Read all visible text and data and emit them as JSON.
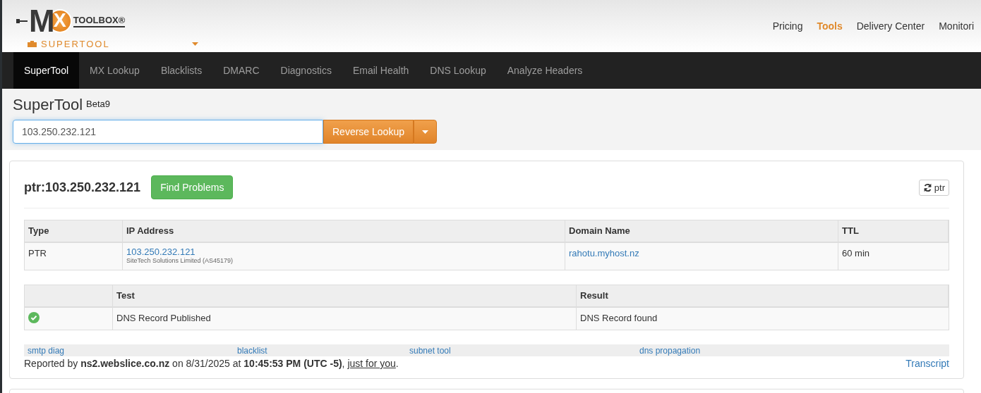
{
  "logo": {
    "letter_m": "M",
    "letter_x": "X",
    "wordmark": "TOOLBOX®",
    "product": "SUPERTOOL"
  },
  "top_nav": [
    {
      "label": "Pricing",
      "selected": false
    },
    {
      "label": "Tools",
      "selected": true
    },
    {
      "label": "Delivery Center",
      "selected": false
    },
    {
      "label": "Monitori",
      "selected": false
    }
  ],
  "tabs": [
    {
      "label": "SuperTool",
      "selected": true
    },
    {
      "label": "MX Lookup",
      "selected": false
    },
    {
      "label": "Blacklists",
      "selected": false
    },
    {
      "label": "DMARC",
      "selected": false
    },
    {
      "label": "Diagnostics",
      "selected": false
    },
    {
      "label": "Email Health",
      "selected": false
    },
    {
      "label": "DNS Lookup",
      "selected": false
    },
    {
      "label": "Analyze Headers",
      "selected": false
    }
  ],
  "page_title": "SuperTool",
  "page_badge": "Beta9",
  "search": {
    "value": "103.250.232.121",
    "button": "Reverse Lookup"
  },
  "result": {
    "title": "ptr:103.250.232.121",
    "find_button": "Find Problems",
    "refresh_button": "ptr",
    "records": {
      "columns": [
        "Type",
        "IP Address",
        "Domain Name",
        "TTL"
      ],
      "rows": [
        {
          "type": "PTR",
          "ip": "103.250.232.121",
          "ip_owner": "SiteTech Solutions Limited (AS45179)",
          "domain": "rahotu.myhost.nz",
          "ttl": "60 min"
        }
      ]
    },
    "tests": {
      "columns": [
        "Test",
        "Result"
      ],
      "rows": [
        {
          "passed": true,
          "test": "DNS Record Published",
          "result": "DNS Record found"
        }
      ]
    },
    "links": [
      "smtp diag",
      "blacklist",
      "subnet tool",
      "dns propagation"
    ],
    "report": {
      "text": "Reported by **ns2.webslice.co.nz** on 8/31/2025 at **10:45:53 PM (UTC -5)**, ",
      "link": "just for you",
      "end": "."
    },
    "transcript": "Transcript"
  }
}
